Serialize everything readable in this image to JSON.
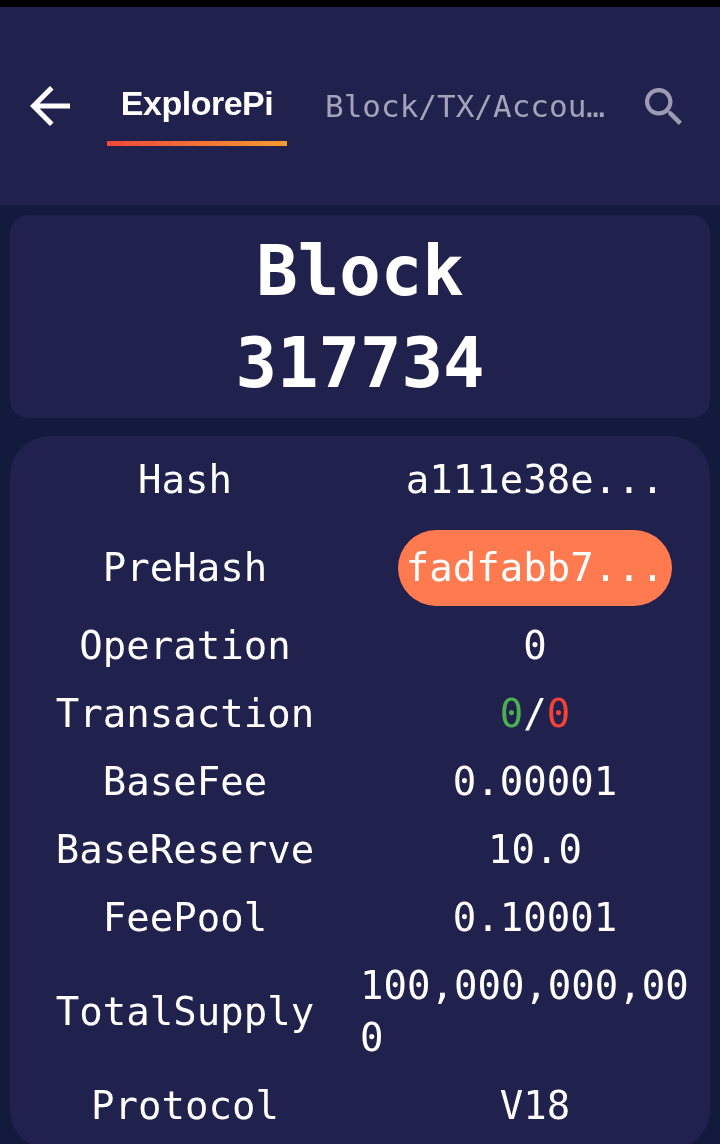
{
  "header": {
    "tabs": [
      {
        "label": "ExplorePi",
        "selected": true
      }
    ],
    "search": {
      "placeholder": "Block/TX/Accou…"
    }
  },
  "block": {
    "title": "Block",
    "number": "317734"
  },
  "details": [
    {
      "kind": "hash",
      "label": "Hash",
      "value": "a111e38e...",
      "highlighted": false
    },
    {
      "kind": "hash",
      "label": "PreHash",
      "value": "fadfabb7...",
      "highlighted": true
    },
    {
      "kind": "text",
      "label": "Operation",
      "value": "0",
      "highlighted": false
    },
    {
      "kind": "counts",
      "label": "Transaction",
      "value_parts": [
        {
          "text": "0",
          "color": "#4caf50"
        },
        {
          "text": "/",
          "color": "#ffffff"
        },
        {
          "text": "0",
          "color": "#f44336"
        }
      ],
      "highlighted": false
    },
    {
      "kind": "text",
      "label": "BaseFee",
      "value": "0.00001",
      "highlighted": false
    },
    {
      "kind": "text",
      "label": "BaseReserve",
      "value": "10.0",
      "highlighted": false
    },
    {
      "kind": "text",
      "label": "FeePool",
      "value": "0.10001",
      "highlighted": false
    },
    {
      "kind": "text",
      "label": "TotalSupply",
      "value": "100,000,000,000",
      "highlighted": false
    },
    {
      "kind": "text",
      "label": "Protocol",
      "value": "V18",
      "highlighted": false
    }
  ]
}
